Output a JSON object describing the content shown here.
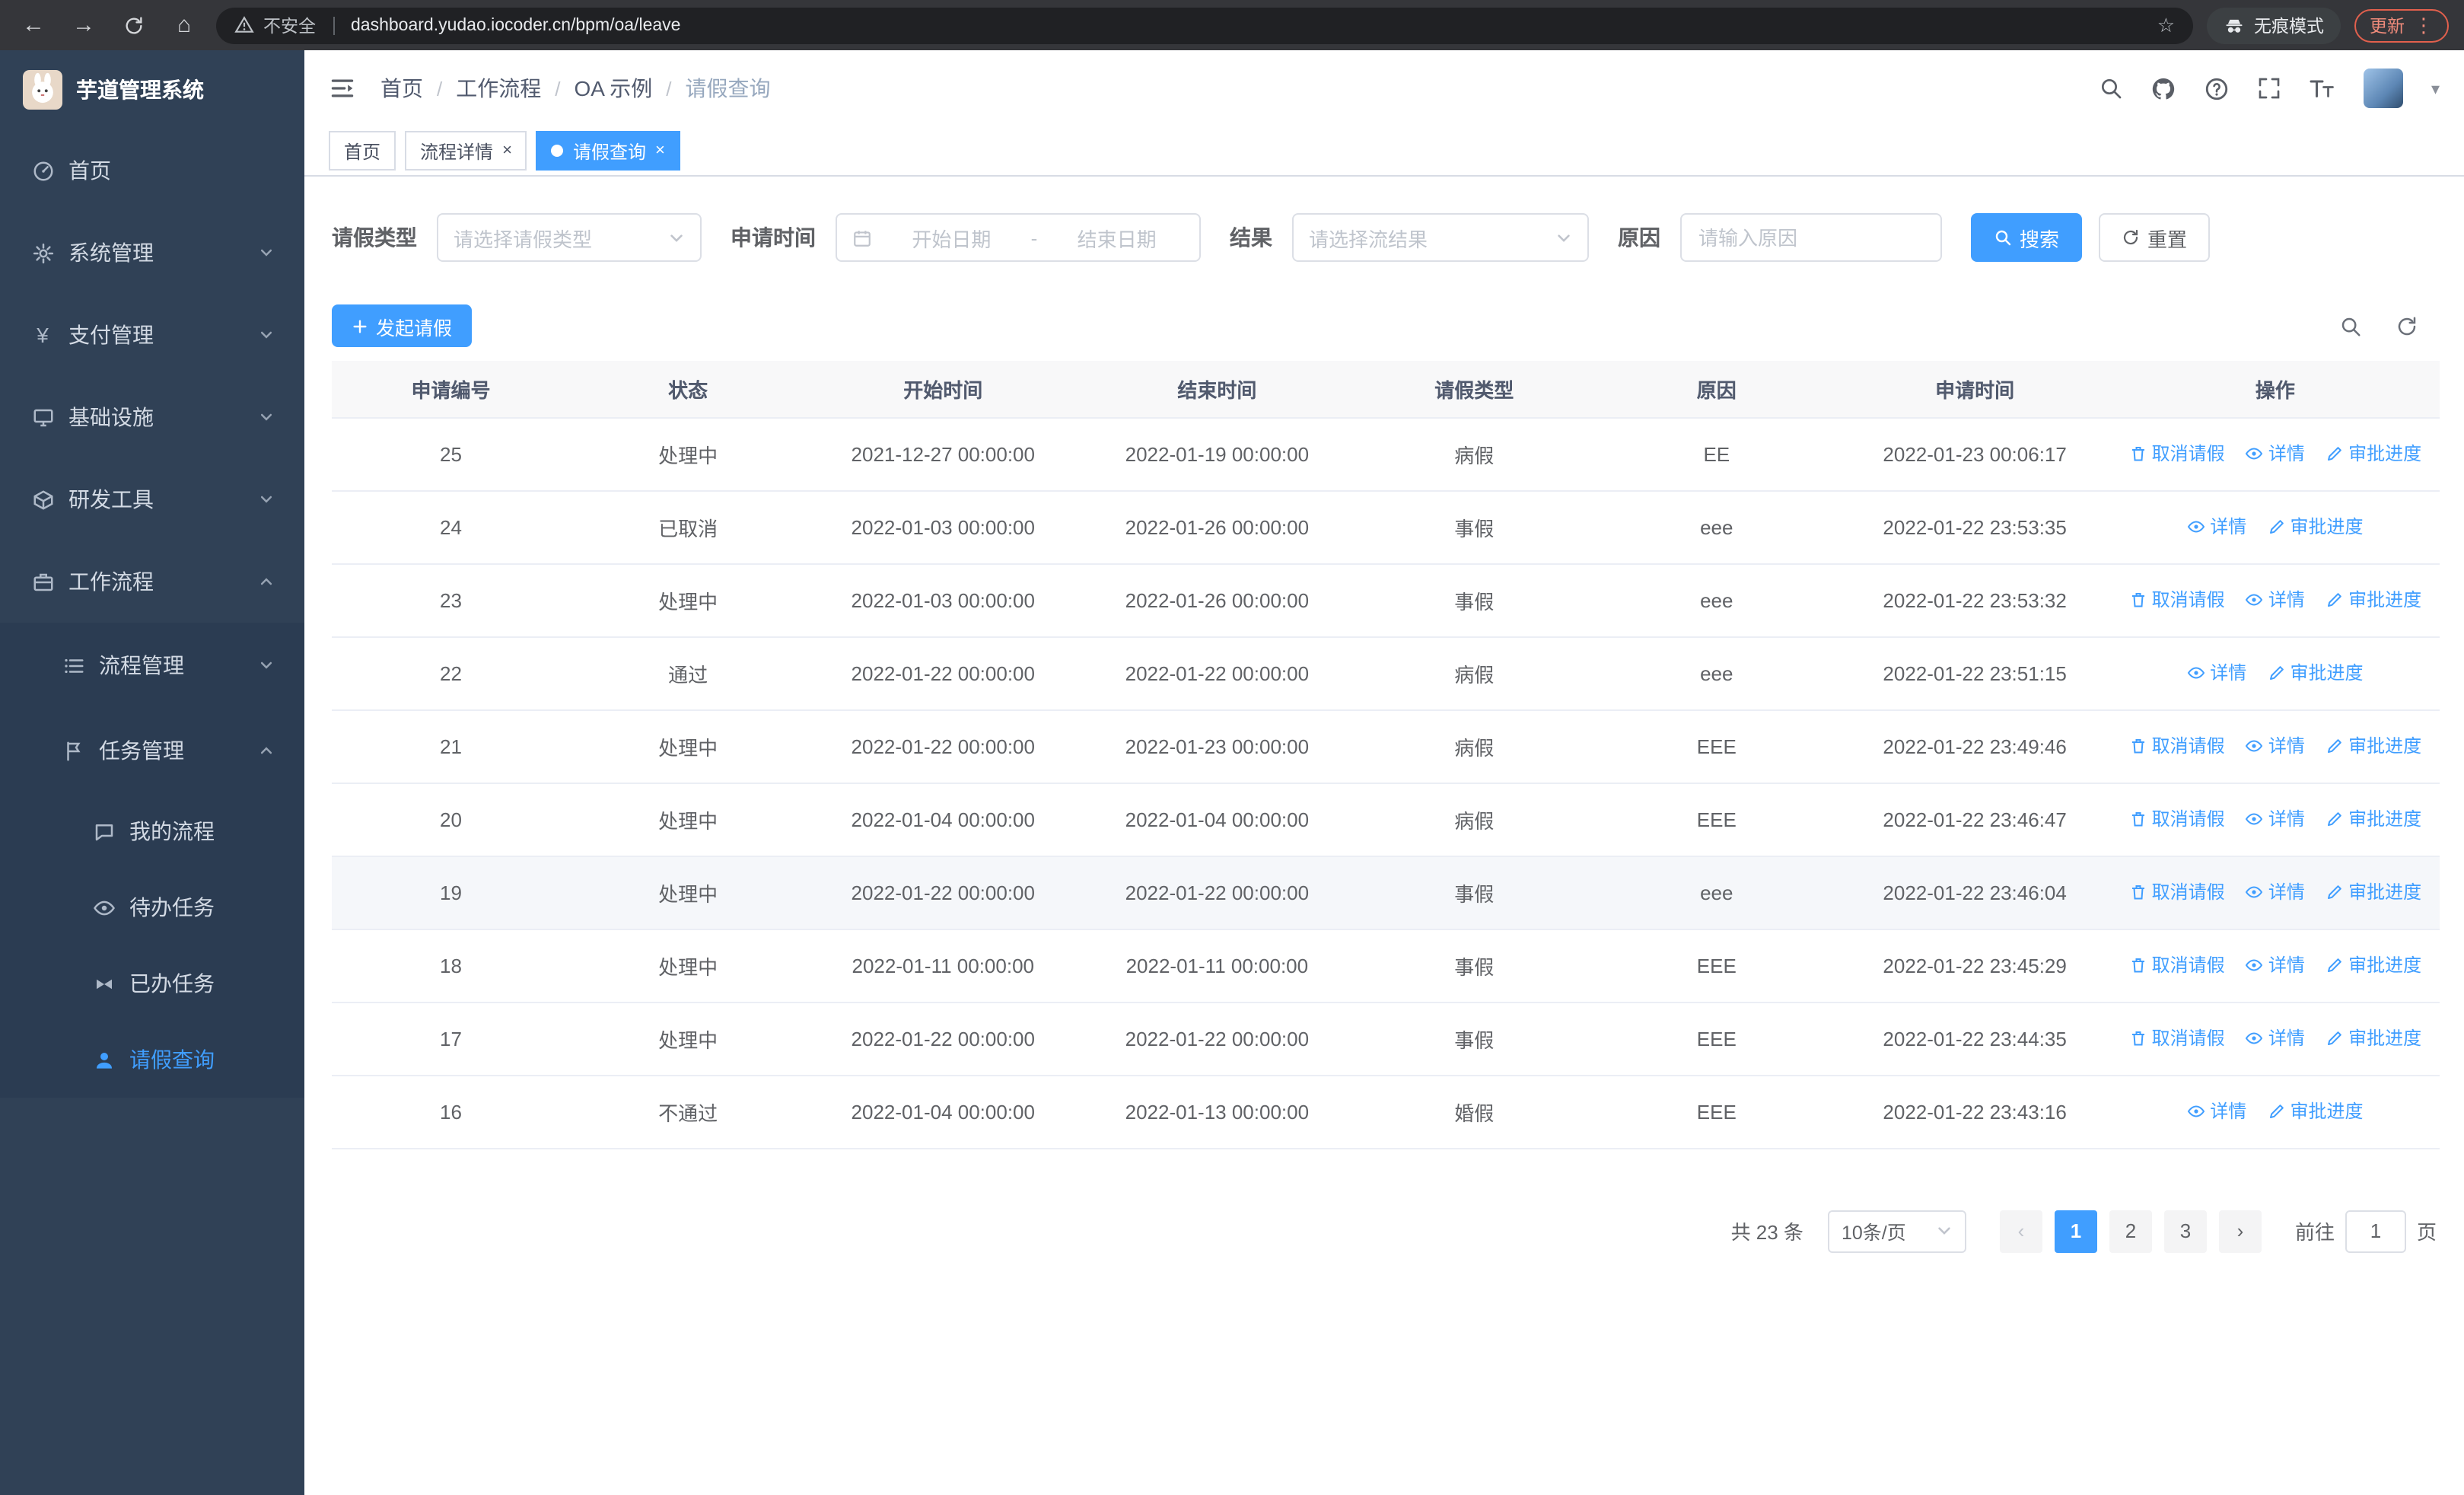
{
  "browser": {
    "back_icon": "←",
    "forward_icon": "→",
    "home_icon": "⌂",
    "star_icon": "☆",
    "kebab_icon": "⋮",
    "security_warning": "不安全",
    "url": "dashboard.yudao.iocoder.cn/bpm/oa/leave",
    "incognito_label": "无痕模式",
    "update_button": "更新"
  },
  "sidebar": {
    "app_title": "芋道管理系统",
    "items": [
      {
        "label": "首页"
      },
      {
        "label": "系统管理"
      },
      {
        "label": "支付管理"
      },
      {
        "label": "基础设施"
      },
      {
        "label": "研发工具"
      },
      {
        "label": "工作流程"
      }
    ],
    "workflow_children": [
      {
        "label": "流程管理"
      },
      {
        "label": "任务管理"
      }
    ],
    "task_children": [
      {
        "label": "我的流程"
      },
      {
        "label": "待办任务"
      },
      {
        "label": "已办任务"
      },
      {
        "label": "请假查询"
      }
    ]
  },
  "header": {
    "breadcrumb": [
      "首页",
      "工作流程",
      "OA 示例",
      "请假查询"
    ],
    "separator": "/"
  },
  "tabs": [
    {
      "label": "首页"
    },
    {
      "label": "流程详情",
      "close": "×"
    },
    {
      "label": "请假查询",
      "close": "×"
    }
  ],
  "filters": {
    "leave_type_label": "请假类型",
    "leave_type_placeholder": "请选择请假类型",
    "apply_time_label": "申请时间",
    "date_start_placeholder": "开始日期",
    "date_separator": "-",
    "date_end_placeholder": "结束日期",
    "result_label": "结果",
    "result_placeholder": "请选择流结果",
    "reason_label": "原因",
    "reason_placeholder": "请输入原因",
    "search_button": "搜索",
    "reset_button": "重置"
  },
  "toolbar": {
    "create_button": "发起请假"
  },
  "table": {
    "columns": [
      "申请编号",
      "状态",
      "开始时间",
      "结束时间",
      "请假类型",
      "原因",
      "申请时间",
      "操作"
    ],
    "action_cancel": "取消请假",
    "action_detail": "详情",
    "action_progress": "审批进度",
    "rows": [
      {
        "id": "25",
        "status": "处理中",
        "start": "2021-12-27 00:00:00",
        "end": "2022-01-19 00:00:00",
        "type": "病假",
        "reason": "EE",
        "apply_time": "2022-01-23 00:06:17",
        "cancellable": true,
        "hover": false
      },
      {
        "id": "24",
        "status": "已取消",
        "start": "2022-01-03 00:00:00",
        "end": "2022-01-26 00:00:00",
        "type": "事假",
        "reason": "eee",
        "apply_time": "2022-01-22 23:53:35",
        "cancellable": false,
        "hover": false
      },
      {
        "id": "23",
        "status": "处理中",
        "start": "2022-01-03 00:00:00",
        "end": "2022-01-26 00:00:00",
        "type": "事假",
        "reason": "eee",
        "apply_time": "2022-01-22 23:53:32",
        "cancellable": true,
        "hover": false
      },
      {
        "id": "22",
        "status": "通过",
        "start": "2022-01-22 00:00:00",
        "end": "2022-01-22 00:00:00",
        "type": "病假",
        "reason": "eee",
        "apply_time": "2022-01-22 23:51:15",
        "cancellable": false,
        "hover": false
      },
      {
        "id": "21",
        "status": "处理中",
        "start": "2022-01-22 00:00:00",
        "end": "2022-01-23 00:00:00",
        "type": "病假",
        "reason": "EEE",
        "apply_time": "2022-01-22 23:49:46",
        "cancellable": true,
        "hover": false
      },
      {
        "id": "20",
        "status": "处理中",
        "start": "2022-01-04 00:00:00",
        "end": "2022-01-04 00:00:00",
        "type": "病假",
        "reason": "EEE",
        "apply_time": "2022-01-22 23:46:47",
        "cancellable": true,
        "hover": false
      },
      {
        "id": "19",
        "status": "处理中",
        "start": "2022-01-22 00:00:00",
        "end": "2022-01-22 00:00:00",
        "type": "事假",
        "reason": "eee",
        "apply_time": "2022-01-22 23:46:04",
        "cancellable": true,
        "hover": true
      },
      {
        "id": "18",
        "status": "处理中",
        "start": "2022-01-11 00:00:00",
        "end": "2022-01-11 00:00:00",
        "type": "事假",
        "reason": "EEE",
        "apply_time": "2022-01-22 23:45:29",
        "cancellable": true,
        "hover": false
      },
      {
        "id": "17",
        "status": "处理中",
        "start": "2022-01-22 00:00:00",
        "end": "2022-01-22 00:00:00",
        "type": "事假",
        "reason": "EEE",
        "apply_time": "2022-01-22 23:44:35",
        "cancellable": true,
        "hover": false
      },
      {
        "id": "16",
        "status": "不通过",
        "start": "2022-01-04 00:00:00",
        "end": "2022-01-13 00:00:00",
        "type": "婚假",
        "reason": "EEE",
        "apply_time": "2022-01-22 23:43:16",
        "cancellable": false,
        "hover": false
      }
    ]
  },
  "pagination": {
    "total": "共 23 条",
    "page_size": "10条/页",
    "prev_icon": "‹",
    "next_icon": "›",
    "pages": [
      "1",
      "2",
      "3"
    ],
    "goto_label": "前往",
    "goto_value": "1",
    "goto_suffix": "页"
  },
  "colors": {
    "primary": "#409eff",
    "sidebar_bg": "#304156",
    "submenu_bg": "#2b3c52",
    "table_header_bg": "#f8f8f9",
    "border": "#ebeef5"
  }
}
